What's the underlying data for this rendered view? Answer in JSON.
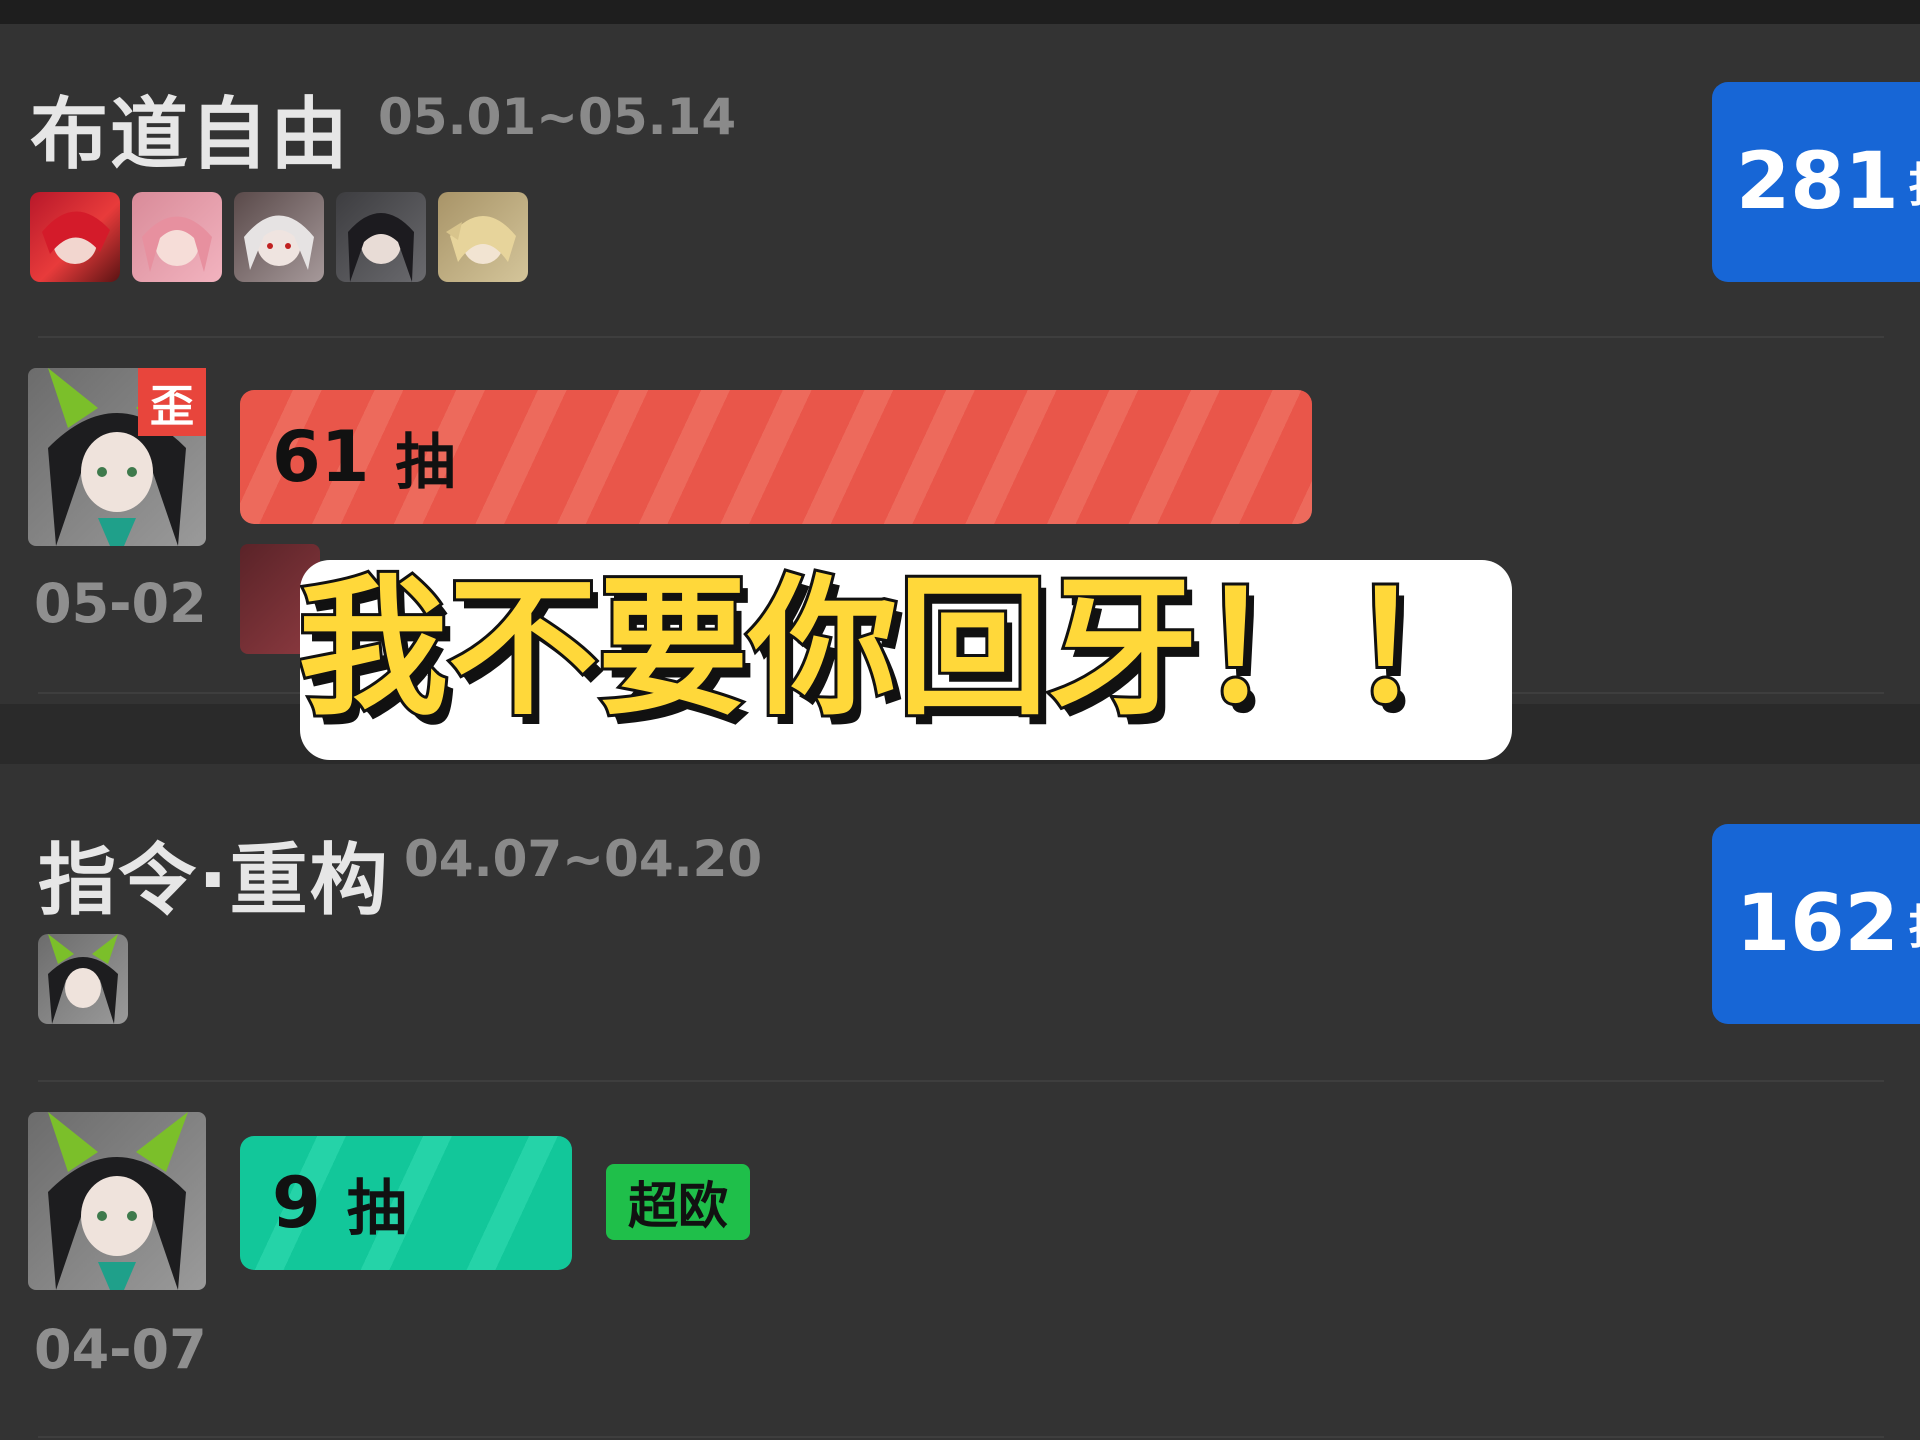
{
  "banners": [
    {
      "name": "布道自由",
      "dates": "05.01~05.14",
      "total_count": "281",
      "total_unit": "抽",
      "pull": {
        "count": "61",
        "unit": "抽",
        "date": "05-02",
        "tag": "歪"
      }
    },
    {
      "name": "指令·重构",
      "dates": "04.07~04.20",
      "total_count": "162",
      "total_unit": "抽",
      "pull": {
        "count": "9",
        "unit": "抽",
        "date": "04-07",
        "tag": "超欧"
      }
    }
  ],
  "caption": "我不要你回牙！！",
  "colors": {
    "background": "#333333",
    "badge_blue": "#1766d6",
    "bar_red": "#e9564a",
    "bar_green": "#12c79a",
    "tag_red": "#e8453c",
    "tag_green": "#1fbf4a",
    "caption_yellow": "#ffd83a"
  }
}
